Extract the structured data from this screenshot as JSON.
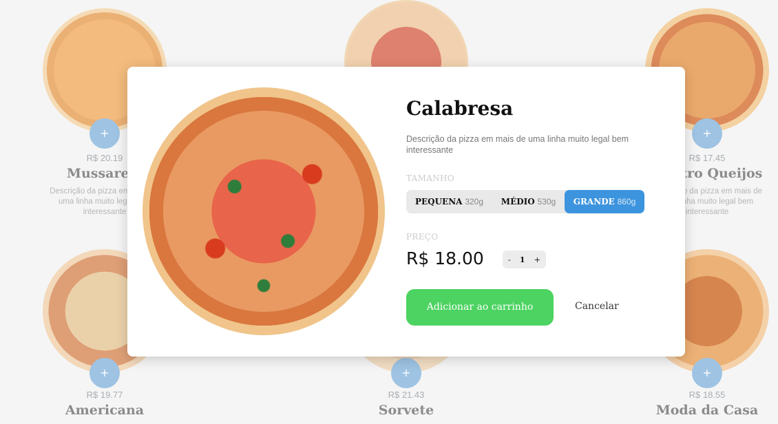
{
  "menu": {
    "cards": [
      {
        "price": "R$ 20.19",
        "name": "Mussarela",
        "desc": "Descrição da pizza em mais de uma linha muito legal bem interessante",
        "add": "+"
      },
      {
        "price": "",
        "name": "",
        "desc": "",
        "add": "+"
      },
      {
        "price": "R$ 17.45",
        "name": "Quatro Queijos",
        "desc": "Descrição da pizza em mais de uma linha muito legal bem interessante",
        "add": "+"
      },
      {
        "price": "R$ 19.77",
        "name": "Americana",
        "desc": "",
        "add": "+"
      },
      {
        "price": "R$ 21.43",
        "name": "Sorvete",
        "desc": "",
        "add": "+"
      },
      {
        "price": "R$ 18.55",
        "name": "Moda da Casa",
        "desc": "",
        "add": "+"
      }
    ]
  },
  "modal": {
    "title": "Calabresa",
    "description": "Descrição da pizza em mais de uma linha muito legal bem interessante",
    "size_label": "TAMANHO",
    "sizes": [
      {
        "name": "PEQUENA",
        "weight": "320g"
      },
      {
        "name": "MÉDIO",
        "weight": "530g"
      },
      {
        "name": "GRANDE",
        "weight": "860g",
        "selected": true
      }
    ],
    "price_label": "PREÇO",
    "price": "R$ 18.00",
    "qty_minus": "-",
    "qty_value": "1",
    "qty_plus": "+",
    "add_to_cart": "Adicionar ao carrinho",
    "cancel": "Cancelar"
  },
  "colors": {
    "accent_blue": "#3d94de",
    "add_green": "#4cd361",
    "card_button": "#8db9de"
  }
}
